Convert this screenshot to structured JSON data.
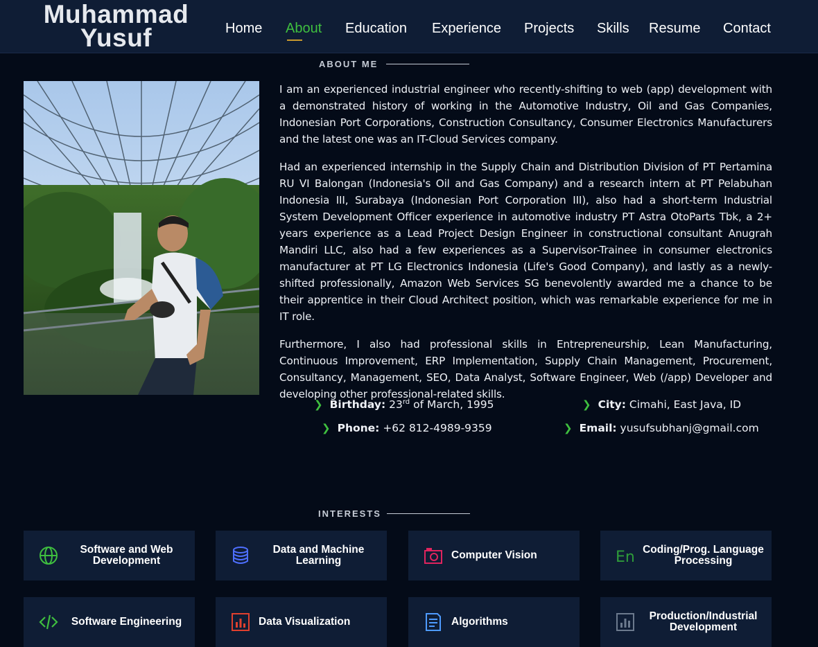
{
  "header": {
    "brand_line1": "Muhammad",
    "brand_line2": "Yusuf",
    "nav": [
      {
        "label": "Home",
        "active": false
      },
      {
        "label": "About",
        "active": true
      },
      {
        "label": "Education",
        "active": false
      },
      {
        "label": "Experience",
        "active": false
      },
      {
        "label": "Projects",
        "active": false
      },
      {
        "label": "Skills",
        "active": false
      },
      {
        "label": "Resume",
        "active": false
      },
      {
        "label": "Contact",
        "active": false
      }
    ]
  },
  "about": {
    "title": "ABOUT ME",
    "paragraphs": [
      "I am an experienced industrial engineer who recently-shifting to web (app) development with a demonstrated history of working in the Automotive Industry, Oil and Gas Companies, Indonesian Port Corporations, Construction Consultancy, Consumer Electronics Manufacturers and the latest one was an IT-Cloud Services company.",
      "Had an experienced internship in the Supply Chain and Distribution Division of PT Pertamina RU VI Balongan (Indonesia's Oil and Gas Company) and a research intern at PT Pelabuhan Indonesia III, Surabaya (Indonesian Port Corporation III), also had a short-term Industrial System Development Officer experience in automotive industry PT Astra OtoParts Tbk, a 2+ years experience as a Lead Project Design Engineer in constructional consultant Anugrah Mandiri LLC, also had a few experiences as a Supervisor-Trainee in consumer electronics manufacturer at PT LG Electronics Indonesia (Life's Good Company), and lastly as a newly-shifted professionally, Amazon Web Services SG benevolently awarded me a chance to be their apprentice in their Cloud Architect position, which was remarkable experience for me in IT role.",
      "Furthermore, I also had professional skills in Entrepreneurship, Lean Manufacturing, Continuous Improvement, ERP Implementation, Supply Chain Management, Procurement, Consultancy, Management, SEO, Data Analyst, Software Engineer, Web (/app) Developer and developing other professional-related skills."
    ],
    "info": {
      "birthday_label": "Birthday:",
      "birthday_day": "23",
      "birthday_suffix": "rd",
      "birthday_rest": "of March, 1995",
      "city_label": "City:",
      "city_value": "Cimahi, East Java, ID",
      "phone_label": "Phone:",
      "phone_value": "+62 812-4989-9359",
      "email_label": "Email:",
      "email_value": "yusufsubhanj@gmail.com"
    }
  },
  "interests": {
    "title": "INTERESTS",
    "cards": [
      {
        "label": "Software and Web Development",
        "icon": "globe-icon",
        "color": "#3fbf3f"
      },
      {
        "label": "Data and Machine Learning",
        "icon": "database-icon",
        "color": "#4e6fff"
      },
      {
        "label": "Computer Vision",
        "icon": "camera-icon",
        "color": "#e0245e"
      },
      {
        "label": "Coding/Prog. Language Processing",
        "icon": "language-icon",
        "color": "#2e9b3a"
      },
      {
        "label": "Software Engineering",
        "icon": "code-icon",
        "color": "#3fbf3f"
      },
      {
        "label": "Data Visualization",
        "icon": "bar-chart-icon",
        "color": "#e0402e"
      },
      {
        "label": "Algorithms",
        "icon": "document-icon",
        "color": "#4e9bff"
      },
      {
        "label": "Production/Industrial Development",
        "icon": "chart-box-icon",
        "color": "#6c7a8e"
      }
    ]
  }
}
